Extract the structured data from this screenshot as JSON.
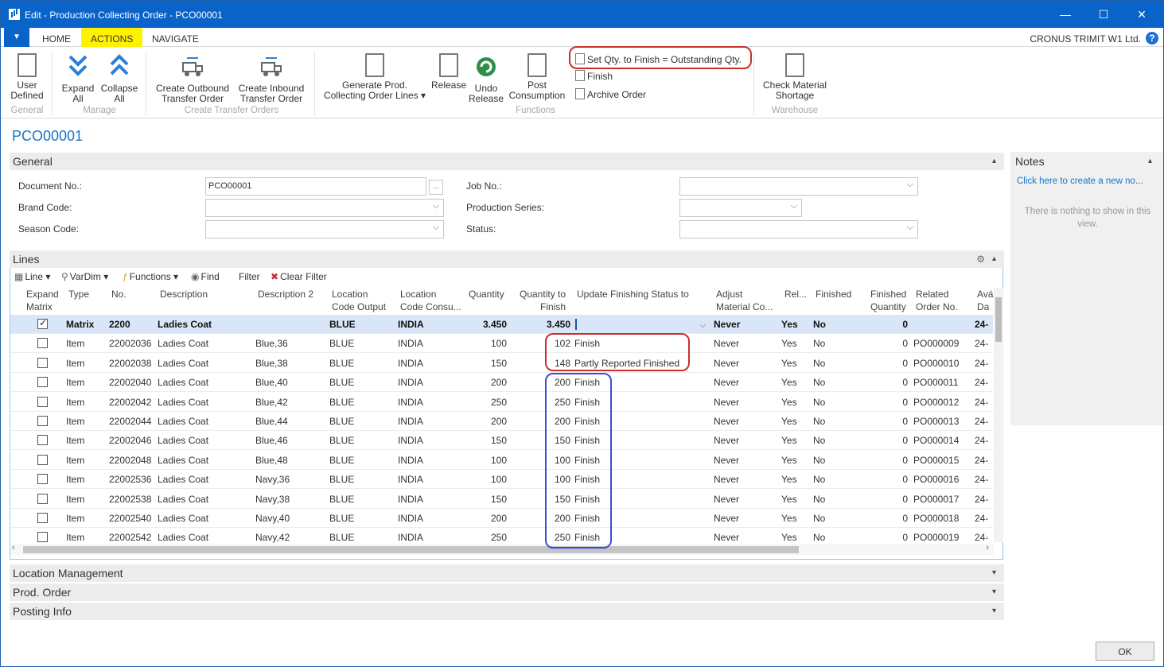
{
  "window": {
    "title": "Edit - Production Collecting Order - PCO00001",
    "minimize": "—",
    "maximize": "☐",
    "close": "✕"
  },
  "tabs": {
    "menu": "▼",
    "home": "HOME",
    "actions": "ACTIONS",
    "navigate": "NAVIGATE",
    "company": "CRONUS TRIMIT W1 Ltd.",
    "help": "?"
  },
  "ribbon": {
    "user_defined": [
      "User",
      "Defined"
    ],
    "expand_all": [
      "Expand",
      "All"
    ],
    "collapse_all": [
      "Collapse",
      "All"
    ],
    "create_outbound": [
      "Create Outbound",
      "Transfer Order"
    ],
    "create_inbound": [
      "Create Inbound",
      "Transfer Order"
    ],
    "generate_lines": [
      "Generate Prod.",
      "Collecting Order Lines ▾"
    ],
    "release": "Release",
    "undo_release": [
      "Undo",
      "Release"
    ],
    "post_consumption": [
      "Post",
      "Consumption"
    ],
    "set_qty": "Set Qty. to Finish = Outstanding Qty.",
    "finish": "Finish",
    "archive_order": "Archive Order",
    "check_material": [
      "Check Material",
      "Shortage"
    ],
    "groups": {
      "general": "General",
      "manage": "Manage",
      "create_transfer": "Create Transfer Orders",
      "functions": "Functions",
      "warehouse": "Warehouse"
    }
  },
  "page_title": "PCO00001",
  "general": {
    "header": "General",
    "caret": "▴",
    "document_no_label": "Document No.:",
    "document_no_value": "PCO00001",
    "assist": "...",
    "brand_code_label": "Brand Code:",
    "season_code_label": "Season Code:",
    "job_no_label": "Job No.:",
    "production_series_label": "Production Series:",
    "status_label": "Status:",
    "dropdown": "⌵"
  },
  "notes": {
    "header": "Notes",
    "caret": "▴",
    "link": "Click here to create a new no...",
    "empty": "There is nothing to show in this view."
  },
  "lines": {
    "header": "Lines",
    "caret": "▴",
    "settings_icon": "⚙",
    "toolbar": {
      "line": "Line ▾",
      "vardim": "VarDim ▾",
      "functions": "Functions ▾",
      "find": "Find",
      "filter": "Filter",
      "clear_filter": "Clear Filter"
    },
    "columns": {
      "expand_matrix": [
        "Expand",
        "Matrix"
      ],
      "type": "Type",
      "no": "No.",
      "description": "Description",
      "description2": "Description 2",
      "location_output": [
        "Location",
        "Code Output"
      ],
      "location_consu": [
        "Location",
        "Code Consu..."
      ],
      "quantity": "Quantity",
      "qty_to_finish": [
        "Quantity to",
        "Finish"
      ],
      "update_status": "Update Finishing Status to",
      "adjust_material": [
        "Adjust",
        "Material Co..."
      ],
      "rel": "Rel...",
      "finished": "Finished",
      "finished_qty": [
        "Finished",
        "Quantity"
      ],
      "related_order": [
        "Related",
        "Order No."
      ],
      "avail": [
        "Avá",
        "Da"
      ]
    },
    "rows": [
      {
        "checked": true,
        "type": "Matrix",
        "no": "2200",
        "desc": "Ladies Coat",
        "desc2": "",
        "loc_out": "BLUE",
        "loc_con": "INDIA",
        "qty": "3.450",
        "qty_finish": "3.450",
        "status": "",
        "adjust": "Never",
        "rel": "Yes",
        "finished": "No",
        "fin_qty": "0",
        "order": "",
        "avail": "24-"
      },
      {
        "checked": false,
        "type": "Item",
        "no": "22002036",
        "desc": "Ladies Coat",
        "desc2": "Blue,36",
        "loc_out": "BLUE",
        "loc_con": "INDIA",
        "qty": "100",
        "qty_finish": "102",
        "status": "Finish",
        "adjust": "Never",
        "rel": "Yes",
        "finished": "No",
        "fin_qty": "0",
        "order": "PO000009",
        "avail": "24-"
      },
      {
        "checked": false,
        "type": "Item",
        "no": "22002038",
        "desc": "Ladies Coat",
        "desc2": "Blue,38",
        "loc_out": "BLUE",
        "loc_con": "INDIA",
        "qty": "150",
        "qty_finish": "148",
        "status": "Partly Reported Finished",
        "adjust": "Never",
        "rel": "Yes",
        "finished": "No",
        "fin_qty": "0",
        "order": "PO000010",
        "avail": "24-"
      },
      {
        "checked": false,
        "type": "Item",
        "no": "22002040",
        "desc": "Ladies Coat",
        "desc2": "Blue,40",
        "loc_out": "BLUE",
        "loc_con": "INDIA",
        "qty": "200",
        "qty_finish": "200",
        "status": "Finish",
        "adjust": "Never",
        "rel": "Yes",
        "finished": "No",
        "fin_qty": "0",
        "order": "PO000011",
        "avail": "24-"
      },
      {
        "checked": false,
        "type": "Item",
        "no": "22002042",
        "desc": "Ladies Coat",
        "desc2": "Blue,42",
        "loc_out": "BLUE",
        "loc_con": "INDIA",
        "qty": "250",
        "qty_finish": "250",
        "status": "Finish",
        "adjust": "Never",
        "rel": "Yes",
        "finished": "No",
        "fin_qty": "0",
        "order": "PO000012",
        "avail": "24-"
      },
      {
        "checked": false,
        "type": "Item",
        "no": "22002044",
        "desc": "Ladies Coat",
        "desc2": "Blue,44",
        "loc_out": "BLUE",
        "loc_con": "INDIA",
        "qty": "200",
        "qty_finish": "200",
        "status": "Finish",
        "adjust": "Never",
        "rel": "Yes",
        "finished": "No",
        "fin_qty": "0",
        "order": "PO000013",
        "avail": "24-"
      },
      {
        "checked": false,
        "type": "Item",
        "no": "22002046",
        "desc": "Ladies Coat",
        "desc2": "Blue,46",
        "loc_out": "BLUE",
        "loc_con": "INDIA",
        "qty": "150",
        "qty_finish": "150",
        "status": "Finish",
        "adjust": "Never",
        "rel": "Yes",
        "finished": "No",
        "fin_qty": "0",
        "order": "PO000014",
        "avail": "24-"
      },
      {
        "checked": false,
        "type": "Item",
        "no": "22002048",
        "desc": "Ladies Coat",
        "desc2": "Blue,48",
        "loc_out": "BLUE",
        "loc_con": "INDIA",
        "qty": "100",
        "qty_finish": "100",
        "status": "Finish",
        "adjust": "Never",
        "rel": "Yes",
        "finished": "No",
        "fin_qty": "0",
        "order": "PO000015",
        "avail": "24-"
      },
      {
        "checked": false,
        "type": "Item",
        "no": "22002536",
        "desc": "Ladies Coat",
        "desc2": "Navy,36",
        "loc_out": "BLUE",
        "loc_con": "INDIA",
        "qty": "100",
        "qty_finish": "100",
        "status": "Finish",
        "adjust": "Never",
        "rel": "Yes",
        "finished": "No",
        "fin_qty": "0",
        "order": "PO000016",
        "avail": "24-"
      },
      {
        "checked": false,
        "type": "Item",
        "no": "22002538",
        "desc": "Ladies Coat",
        "desc2": "Navy,38",
        "loc_out": "BLUE",
        "loc_con": "INDIA",
        "qty": "150",
        "qty_finish": "150",
        "status": "Finish",
        "adjust": "Never",
        "rel": "Yes",
        "finished": "No",
        "fin_qty": "0",
        "order": "PO000017",
        "avail": "24-"
      },
      {
        "checked": false,
        "type": "Item",
        "no": "22002540",
        "desc": "Ladies Coat",
        "desc2": "Navy,40",
        "loc_out": "BLUE",
        "loc_con": "INDIA",
        "qty": "200",
        "qty_finish": "200",
        "status": "Finish",
        "adjust": "Never",
        "rel": "Yes",
        "finished": "No",
        "fin_qty": "0",
        "order": "PO000018",
        "avail": "24-"
      },
      {
        "checked": false,
        "type": "Item",
        "no": "22002542",
        "desc": "Ladies Coat",
        "desc2": "Navy,42",
        "loc_out": "BLUE",
        "loc_con": "INDIA",
        "qty": "250",
        "qty_finish": "250",
        "status": "Finish",
        "adjust": "Never",
        "rel": "Yes",
        "finished": "No",
        "fin_qty": "0",
        "order": "PO000019",
        "avail": "24-"
      }
    ]
  },
  "fasttabs": {
    "location": "Location Management",
    "prod_order": "Prod. Order",
    "posting": "Posting Info",
    "caret": "▾"
  },
  "ok": "OK",
  "colors": {
    "accent": "#0a63c9",
    "active_tab": "#fff200",
    "annotation_red": "#c9302c",
    "annotation_blue": "#3a4fd8"
  }
}
